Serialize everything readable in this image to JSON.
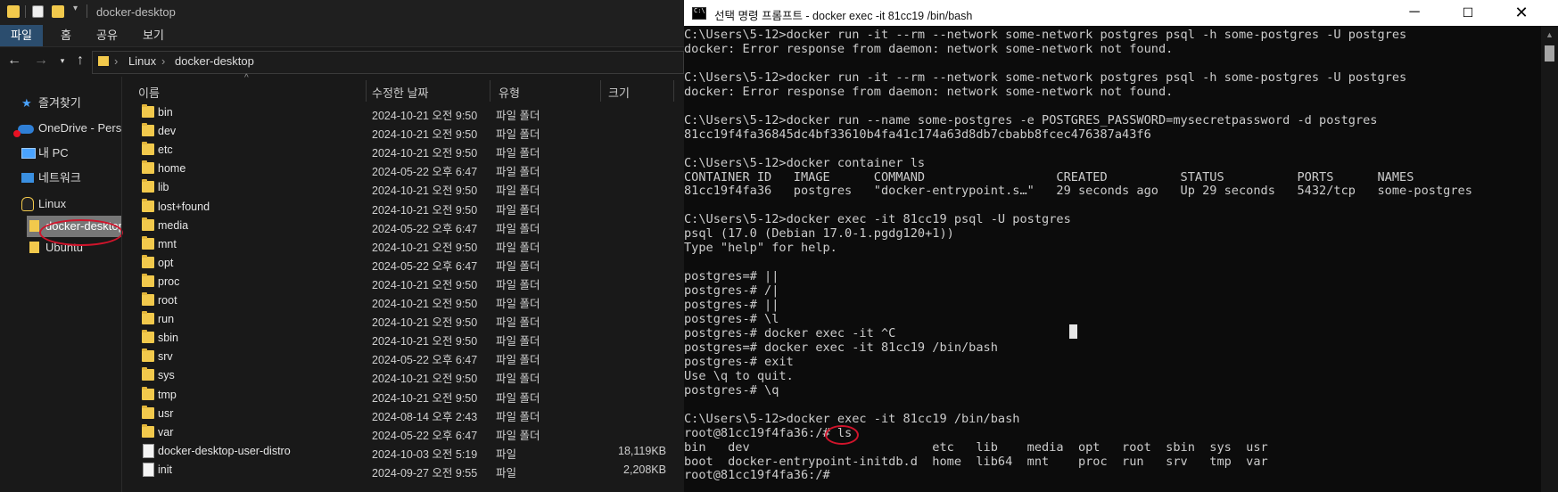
{
  "explorer": {
    "title": "docker-desktop",
    "ribbon_tabs": [
      "파일",
      "홈",
      "공유",
      "보기"
    ],
    "breadcrumb": [
      "Linux",
      "docker-desktop"
    ],
    "sidebar": [
      {
        "label": "즐겨찾기",
        "icon": "star-icon"
      },
      {
        "label": "OneDrive - Perso",
        "icon": "cloud-icon"
      },
      {
        "label": "내 PC",
        "icon": "computer-icon"
      },
      {
        "label": "네트워크",
        "icon": "network-icon"
      },
      {
        "label": "Linux",
        "icon": "penguin-icon"
      },
      {
        "label": "docker-desktop",
        "icon": "folder-icon"
      },
      {
        "label": "Ubuntu",
        "icon": "folder-icon"
      }
    ],
    "columns": {
      "name": "이름",
      "date": "수정한 날짜",
      "type": "유형",
      "size": "크기"
    },
    "files": [
      {
        "name": "bin",
        "date": "2024-10-21 오전 9:50",
        "type": "파일 폴더",
        "size": "",
        "kind": "folder"
      },
      {
        "name": "dev",
        "date": "2024-10-21 오전 9:50",
        "type": "파일 폴더",
        "size": "",
        "kind": "folder"
      },
      {
        "name": "etc",
        "date": "2024-10-21 오전 9:50",
        "type": "파일 폴더",
        "size": "",
        "kind": "folder"
      },
      {
        "name": "home",
        "date": "2024-05-22 오후 6:47",
        "type": "파일 폴더",
        "size": "",
        "kind": "folder"
      },
      {
        "name": "lib",
        "date": "2024-10-21 오전 9:50",
        "type": "파일 폴더",
        "size": "",
        "kind": "folder"
      },
      {
        "name": "lost+found",
        "date": "2024-10-21 오전 9:50",
        "type": "파일 폴더",
        "size": "",
        "kind": "folder"
      },
      {
        "name": "media",
        "date": "2024-05-22 오후 6:47",
        "type": "파일 폴더",
        "size": "",
        "kind": "folder"
      },
      {
        "name": "mnt",
        "date": "2024-10-21 오전 9:50",
        "type": "파일 폴더",
        "size": "",
        "kind": "folder"
      },
      {
        "name": "opt",
        "date": "2024-05-22 오후 6:47",
        "type": "파일 폴더",
        "size": "",
        "kind": "folder"
      },
      {
        "name": "proc",
        "date": "2024-10-21 오전 9:50",
        "type": "파일 폴더",
        "size": "",
        "kind": "folder"
      },
      {
        "name": "root",
        "date": "2024-10-21 오전 9:50",
        "type": "파일 폴더",
        "size": "",
        "kind": "folder"
      },
      {
        "name": "run",
        "date": "2024-10-21 오전 9:50",
        "type": "파일 폴더",
        "size": "",
        "kind": "folder"
      },
      {
        "name": "sbin",
        "date": "2024-10-21 오전 9:50",
        "type": "파일 폴더",
        "size": "",
        "kind": "folder"
      },
      {
        "name": "srv",
        "date": "2024-05-22 오후 6:47",
        "type": "파일 폴더",
        "size": "",
        "kind": "folder"
      },
      {
        "name": "sys",
        "date": "2024-10-21 오전 9:50",
        "type": "파일 폴더",
        "size": "",
        "kind": "folder"
      },
      {
        "name": "tmp",
        "date": "2024-10-21 오전 9:50",
        "type": "파일 폴더",
        "size": "",
        "kind": "folder"
      },
      {
        "name": "usr",
        "date": "2024-08-14 오후 2:43",
        "type": "파일 폴더",
        "size": "",
        "kind": "folder"
      },
      {
        "name": "var",
        "date": "2024-05-22 오후 6:47",
        "type": "파일 폴더",
        "size": "",
        "kind": "folder"
      },
      {
        "name": "docker-desktop-user-distro",
        "date": "2024-10-03 오전 5:19",
        "type": "파일",
        "size": "18,119KB",
        "kind": "file"
      },
      {
        "name": "init",
        "date": "2024-09-27 오전 9:55",
        "type": "파일",
        "size": "2,208KB",
        "kind": "file"
      }
    ]
  },
  "console": {
    "title": "선택 명령 프롬프트 - docker  exec -it 81cc19 /bin/bash",
    "lines": [
      "C:\\Users\\5-12>docker run -it --rm --network some-network postgres psql -h some-postgres -U postgres",
      "docker: Error response from daemon: network some-network not found.",
      "",
      "C:\\Users\\5-12>docker run -it --rm --network some-network postgres psql -h some-postgres -U postgres",
      "docker: Error response from daemon: network some-network not found.",
      "",
      "C:\\Users\\5-12>docker run --name some-postgres -e POSTGRES_PASSWORD=mysecretpassword -d postgres",
      "81cc19f4fa36845dc4bf33610b4fa41c174a63d8db7cbabb8fcec476387a43f6",
      "",
      "C:\\Users\\5-12>docker container ls",
      "CONTAINER ID   IMAGE      COMMAND                  CREATED          STATUS          PORTS      NAMES",
      "81cc19f4fa36   postgres   \"docker-entrypoint.s…\"   29 seconds ago   Up 29 seconds   5432/tcp   some-postgres",
      "",
      "C:\\Users\\5-12>docker exec -it 81cc19 psql -U postgres",
      "psql (17.0 (Debian 17.0-1.pgdg120+1))",
      "Type \"help\" for help.",
      "",
      "postgres=# ||",
      "postgres-# /|",
      "postgres-# ||",
      "postgres-# \\l",
      "postgres-# docker exec -it ^C",
      "postgres=# docker exec -it 81cc19 /bin/bash",
      "postgres-# exit",
      "Use \\q to quit.",
      "postgres-# \\q",
      "",
      "C:\\Users\\5-12>docker exec -it 81cc19 /bin/bash",
      "root@81cc19f4fa36:/# ls",
      "bin   dev                         etc   lib    media  opt   root  sbin  sys  usr",
      "boot  docker-entrypoint-initdb.d  home  lib64  mnt    proc  run   srv   tmp  var",
      "root@81cc19f4fa36:/#"
    ]
  },
  "colors": {
    "accent": "#2b4d6e",
    "annotation": "#d0142b",
    "folder": "#f2c94c"
  }
}
